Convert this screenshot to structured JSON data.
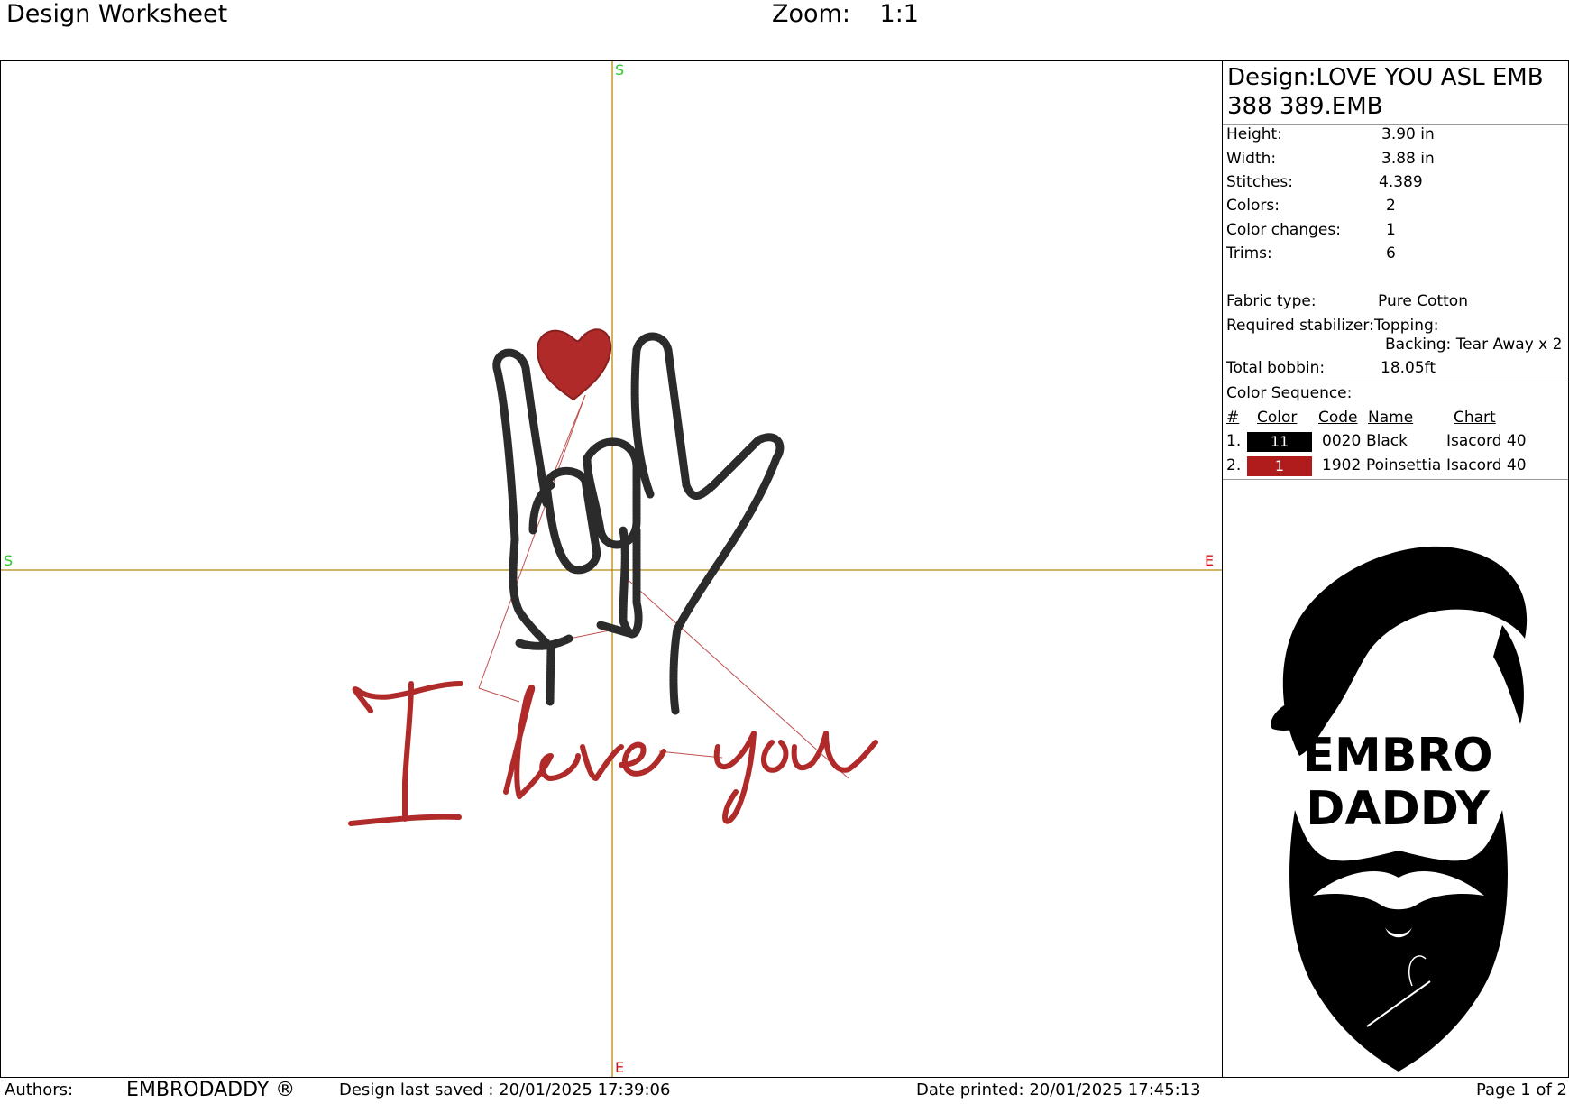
{
  "header": {
    "title": "Design Worksheet",
    "zoom_label": "Zoom:",
    "zoom_value": "1:1"
  },
  "canvas": {
    "axis_markers": {
      "top": "S",
      "left": "S",
      "right": "E",
      "bottom": "E"
    },
    "colors": {
      "thread_black": "#2b2b2b",
      "thread_red": "#b02a2a",
      "crosshair": "#b8860b",
      "jump": "#c05050"
    }
  },
  "design": {
    "name_line1": "Design:LOVE YOU ASL EMB",
    "name_line2": "388 389.EMB",
    "stats": [
      {
        "label": "Height:",
        "value": "3.90 in"
      },
      {
        "label": "Width:",
        "value": "3.88 in"
      },
      {
        "label": "Stitches:",
        "value": "4.389"
      },
      {
        "label": "Colors:",
        "value": "2"
      },
      {
        "label": "Color changes:",
        "value": "1"
      },
      {
        "label": "Trims:",
        "value": "6"
      }
    ],
    "fabric_label": "Fabric type:",
    "fabric_value": "Pure Cotton",
    "stabilizer_label": "Required stabilizer:",
    "topping": "Topping:",
    "backing": "Backing: Tear Away x 2",
    "bobbin_label": "Total bobbin:",
    "bobbin_value": "18.05ft"
  },
  "color_sequence": {
    "title": "Color Sequence:",
    "headers": {
      "num": "#",
      "color": "Color",
      "code": "Code",
      "name": "Name",
      "chart": "Chart"
    },
    "rows": [
      {
        "num": "1.",
        "swatch_label": "11",
        "swatch_color": "#000000",
        "code": "0020",
        "name": "Black",
        "chart": "Isacord 40"
      },
      {
        "num": "2.",
        "swatch_label": "1",
        "swatch_color": "#b01c1c",
        "code": "1902",
        "name": "Poinsettia",
        "chart": "Isacord 40"
      }
    ]
  },
  "logo": {
    "line1": "EMBRO",
    "line2": "DADDY"
  },
  "footer": {
    "authors_label": "Authors:",
    "author": "EMBRODADDY ®",
    "saved": "Design last saved : 20/01/2025 17:39:06",
    "printed": "Date printed: 20/01/2025 17:45:13",
    "page": "Page 1 of 2"
  }
}
